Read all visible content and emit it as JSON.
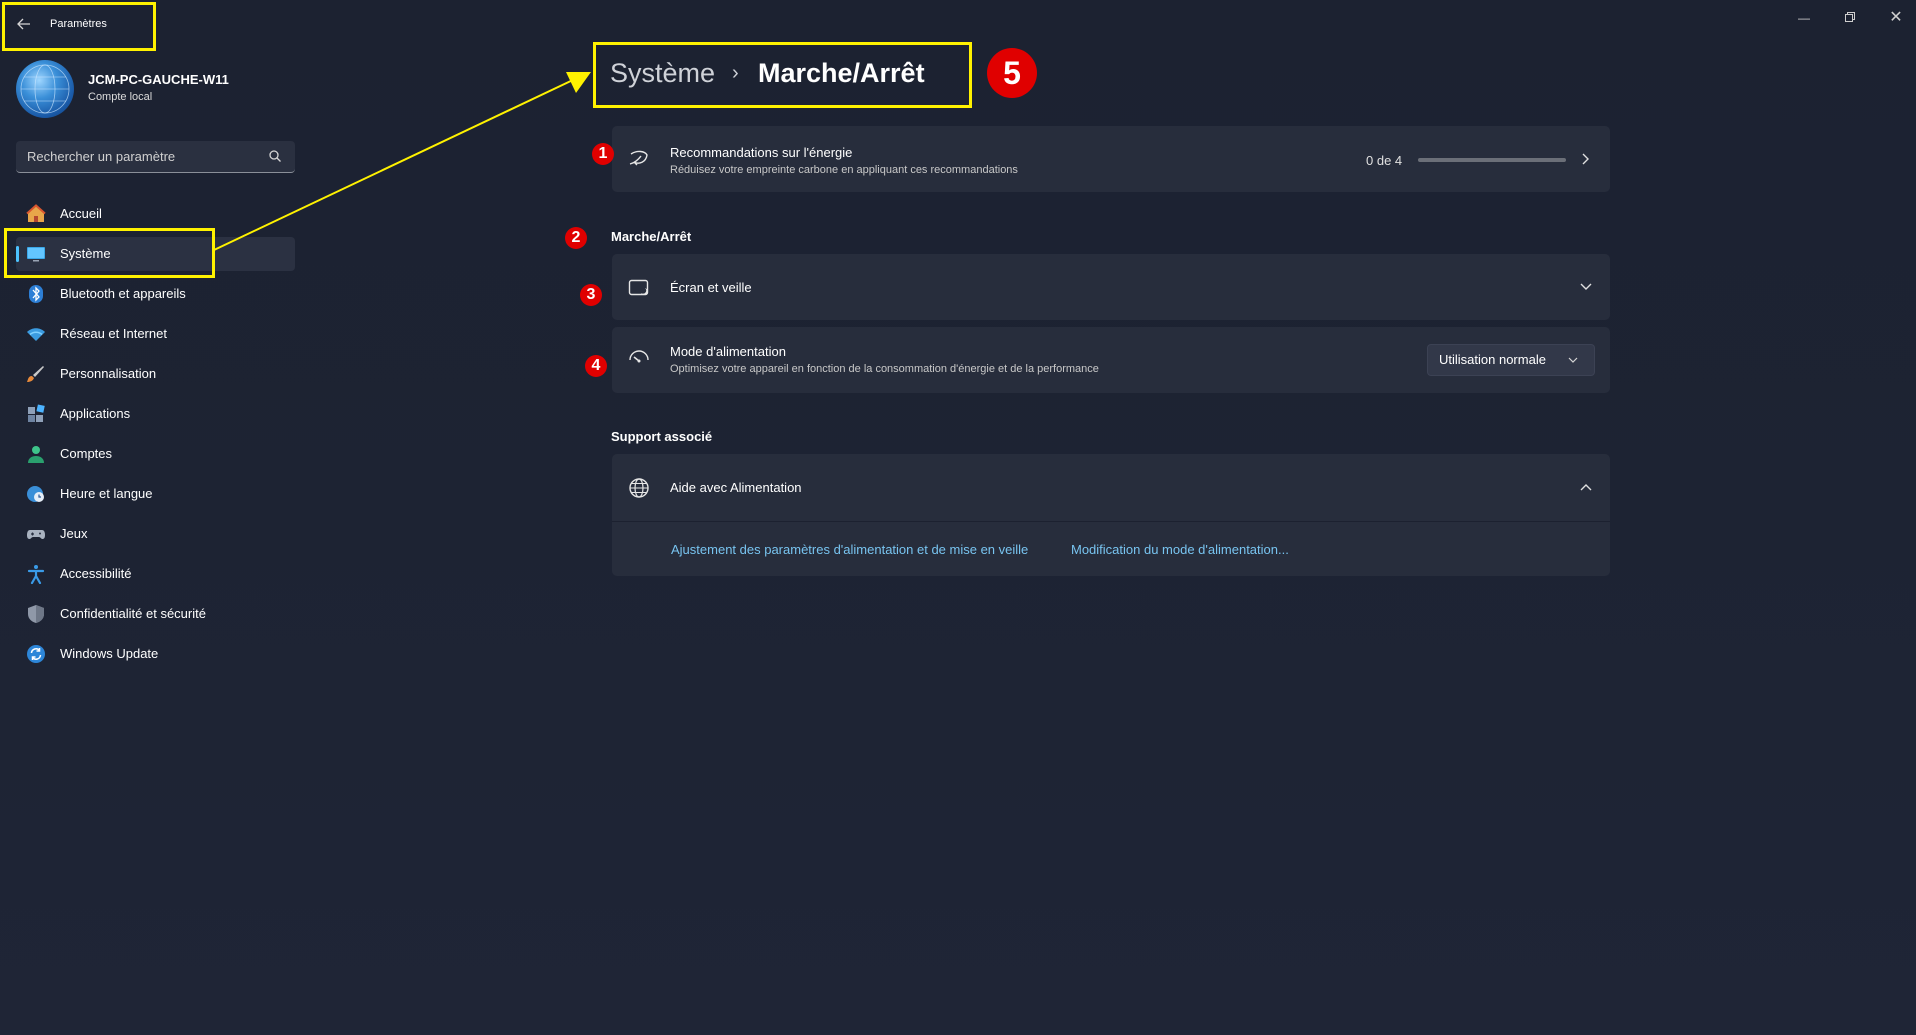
{
  "app": {
    "title": "Paramètres",
    "back_icon": "back-arrow-icon",
    "window_controls": [
      "minimize",
      "restore",
      "close"
    ]
  },
  "profile": {
    "name": "JCM-PC-GAUCHE-W11",
    "account_type": "Compte local"
  },
  "search": {
    "placeholder": "Rechercher un paramètre"
  },
  "sidebar": {
    "items": [
      {
        "label": "Accueil",
        "icon": "home-icon"
      },
      {
        "label": "Système",
        "icon": "display-icon",
        "selected": true
      },
      {
        "label": "Bluetooth et appareils",
        "icon": "bluetooth-icon"
      },
      {
        "label": "Réseau et Internet",
        "icon": "wifi-icon"
      },
      {
        "label": "Personnalisation",
        "icon": "brush-icon"
      },
      {
        "label": "Applications",
        "icon": "apps-icon"
      },
      {
        "label": "Comptes",
        "icon": "person-icon"
      },
      {
        "label": "Heure et langue",
        "icon": "globe-clock-icon"
      },
      {
        "label": "Jeux",
        "icon": "gamepad-icon"
      },
      {
        "label": "Accessibilité",
        "icon": "accessibility-icon"
      },
      {
        "label": "Confidentialité et sécurité",
        "icon": "shield-icon"
      },
      {
        "label": "Windows Update",
        "icon": "update-icon"
      }
    ]
  },
  "breadcrumb": {
    "parent": "Système",
    "separator": "›",
    "current": "Marche/Arrêt"
  },
  "energy": {
    "title": "Recommandations sur l'énergie",
    "subtitle": "Réduisez votre empreinte carbone en appliquant ces recommandations",
    "progress_text": "0 de 4",
    "progress_fraction": 0
  },
  "power_section": {
    "heading": "Marche/Arrêt",
    "screen_sleep": {
      "title": "Écran et veille"
    },
    "power_mode": {
      "title": "Mode d'alimentation",
      "subtitle": "Optimisez votre appareil en fonction de la consommation d'énergie et de la performance",
      "selected": "Utilisation normale"
    }
  },
  "support": {
    "heading": "Support associé",
    "help_title": "Aide avec Alimentation",
    "links": [
      "Ajustement des paramètres d'alimentation et de mise en veille",
      "Modification du mode d'alimentation..."
    ]
  },
  "annotations": {
    "badges": [
      "1",
      "2",
      "3",
      "4",
      "5"
    ],
    "color_highlight": "#fff200",
    "color_badge": "#e00000"
  },
  "colors": {
    "accent": "#4cc2ff",
    "background": "#1d2333",
    "card": "#272d3c",
    "link": "#78c4f0"
  }
}
